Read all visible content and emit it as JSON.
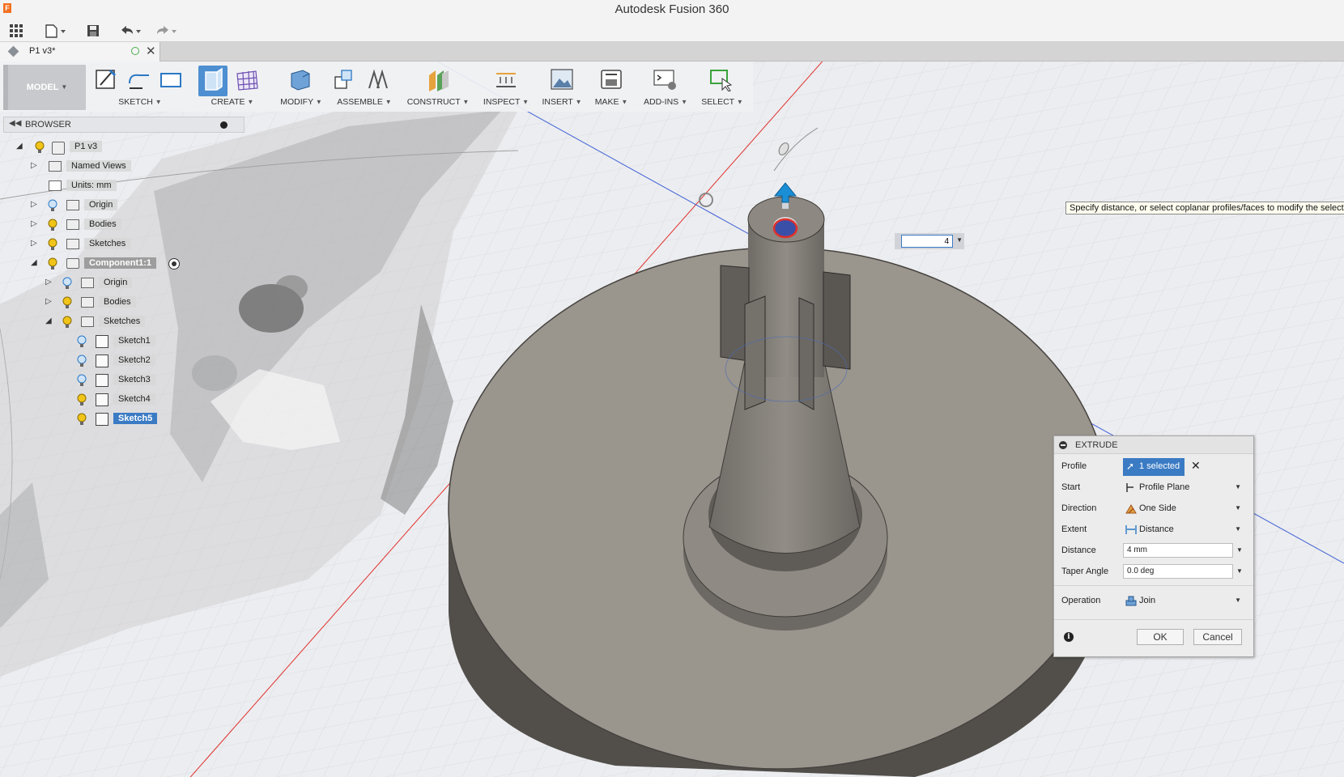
{
  "app": {
    "title": "Autodesk Fusion 360",
    "icon_letter": "F"
  },
  "document_tab": {
    "name": "P1 v3*"
  },
  "toolbar": {
    "workspace": "MODEL",
    "groups": [
      "SKETCH",
      "CREATE",
      "MODIFY",
      "ASSEMBLE",
      "CONSTRUCT",
      "INSPECT",
      "INSERT",
      "MAKE",
      "ADD-INS",
      "SELECT"
    ]
  },
  "browser": {
    "title": "BROWSER",
    "root": "P1 v3",
    "items": [
      {
        "label": "Named Views"
      },
      {
        "label": "Units: mm"
      },
      {
        "label": "Origin"
      },
      {
        "label": "Bodies"
      },
      {
        "label": "Sketches"
      },
      {
        "label": "Component1:1"
      },
      {
        "label": "Origin"
      },
      {
        "label": "Bodies"
      },
      {
        "label": "Sketches"
      },
      {
        "label": "Sketch1"
      },
      {
        "label": "Sketch2"
      },
      {
        "label": "Sketch3"
      },
      {
        "label": "Sketch4"
      },
      {
        "label": "Sketch5"
      }
    ]
  },
  "tooltip": "Specify distance, or select coplanar profiles/faces to modify the selectio",
  "distance_input": {
    "value": "4"
  },
  "extrude": {
    "title": "EXTRUDE",
    "profile_label": "Profile",
    "profile_value": "1 selected",
    "start_label": "Start",
    "start_value": "Profile Plane",
    "direction_label": "Direction",
    "direction_value": "One Side",
    "extent_label": "Extent",
    "extent_value": "Distance",
    "distance_label": "Distance",
    "distance_value": "4 mm",
    "taper_label": "Taper Angle",
    "taper_value": "0.0 deg",
    "operation_label": "Operation",
    "operation_value": "Join",
    "ok_label": "OK",
    "cancel_label": "Cancel"
  },
  "colors": {
    "accent": "#3b7bc4",
    "body": "#8e8a83",
    "axis_red": "#e0302c",
    "axis_blue": "#3d5fd6"
  }
}
